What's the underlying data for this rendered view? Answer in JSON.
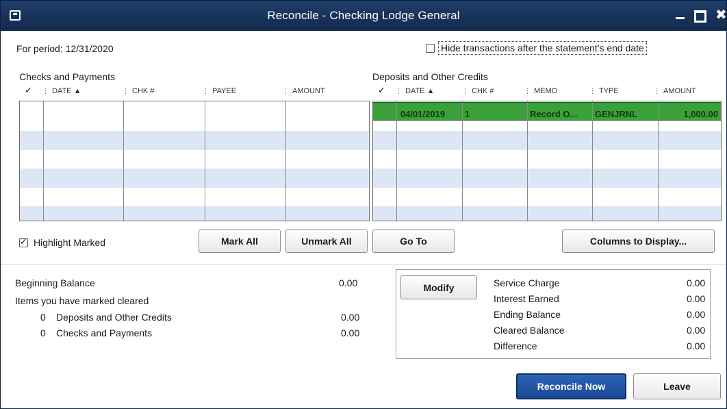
{
  "window": {
    "title": "Reconcile - Checking Lodge General"
  },
  "period": {
    "label": "For period: 12/31/2020"
  },
  "hide_option": {
    "label": "Hide transactions after the statement's end date",
    "checked": false
  },
  "checks": {
    "title": "Checks and Payments",
    "columns": {
      "check": "✓",
      "date": "DATE ▲",
      "chk": "CHK #",
      "payee": "PAYEE",
      "amount": "AMOUNT"
    }
  },
  "deposits": {
    "title": "Deposits and Other Credits",
    "columns": {
      "check": "✓",
      "date": "DATE ▲",
      "chk": "CHK #",
      "memo": "MEMO",
      "type": "TYPE",
      "amount": "AMOUNT"
    },
    "rows": [
      {
        "date": "04/01/2019",
        "chk": "1",
        "memo": "Record O...",
        "type": "GENJRNL",
        "amount": "1,000.00"
      }
    ]
  },
  "highlight_marked": {
    "label": "Highlight Marked",
    "checked": true
  },
  "buttons": {
    "mark_all": "Mark All",
    "unmark_all": "Unmark All",
    "go_to": "Go To",
    "columns_to_display": "Columns to Display...",
    "modify": "Modify",
    "reconcile_now": "Reconcile Now",
    "leave": "Leave"
  },
  "balances": {
    "beginning_label": "Beginning Balance",
    "beginning_value": "0.00",
    "items_marked_label": "Items you have marked cleared",
    "deposits_count": "0",
    "deposits_label": "Deposits and Other Credits",
    "deposits_value": "0.00",
    "checks_count": "0",
    "checks_label": "Checks and Payments",
    "checks_value": "0.00"
  },
  "summary": {
    "service_charge_label": "Service Charge",
    "service_charge_value": "0.00",
    "interest_earned_label": "Interest Earned",
    "interest_earned_value": "0.00",
    "ending_balance_label": "Ending Balance",
    "ending_balance_value": "0.00",
    "cleared_balance_label": "Cleared Balance",
    "cleared_balance_value": "0.00",
    "difference_label": "Difference",
    "difference_value": "0.00"
  },
  "colors": {
    "title_bar": "#17325a",
    "selected_row": "#3aa13a",
    "stripe": "#dde6f4",
    "primary_button": "#1b4a96"
  }
}
